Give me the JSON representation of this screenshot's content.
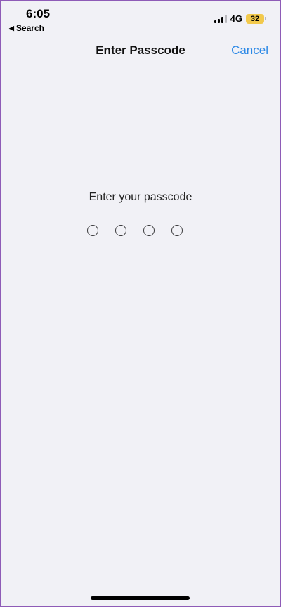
{
  "status_bar": {
    "time": "6:05",
    "network": "4G",
    "battery": "32",
    "back_label": "Search"
  },
  "nav": {
    "title": "Enter Passcode",
    "cancel_label": "Cancel"
  },
  "passcode": {
    "prompt": "Enter your passcode",
    "digits_total": 4,
    "digits_entered": 0
  },
  "colors": {
    "accent": "#2d89e6",
    "background": "#f1f1f6",
    "battery_fill": "#f2c94c"
  }
}
